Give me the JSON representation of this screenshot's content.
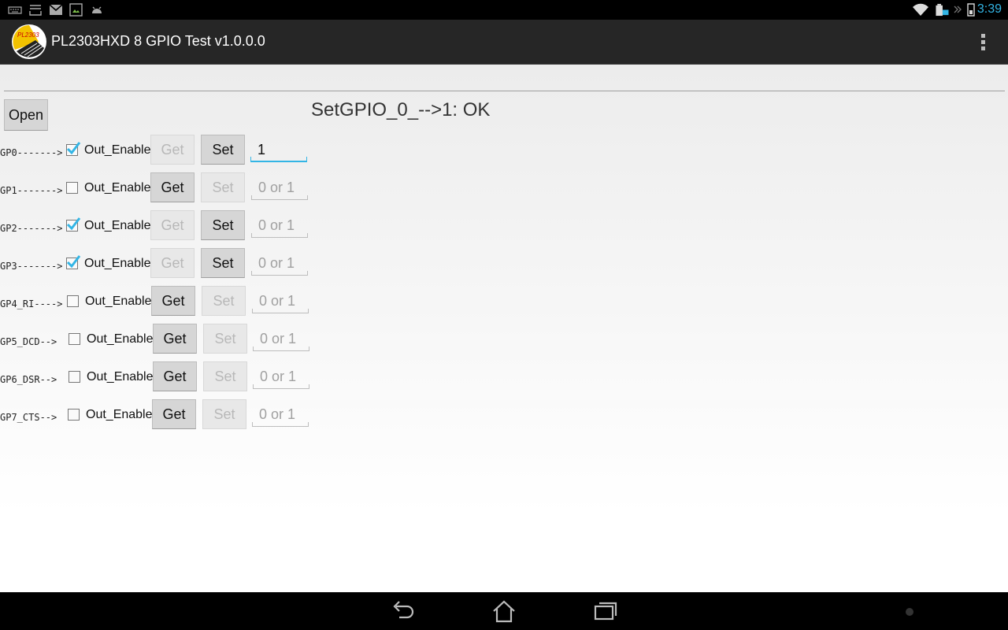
{
  "statusbar": {
    "time": "3:39",
    "accent": "#33b5e5"
  },
  "actionbar": {
    "title": "PL2303HXD 8 GPIO Test v1.0.0.0",
    "logo_text": "PL2303",
    "menu_icon": "overflow-menu-icon"
  },
  "main": {
    "open_label": "Open",
    "status": "SetGPIO_0_-->1: OK"
  },
  "rows": [
    {
      "gp": "GP0------->",
      "checked": true,
      "oe": "Out_Enable",
      "get": "Get",
      "set": "Set",
      "get_enabled": false,
      "set_enabled": true,
      "value": "1",
      "placeholder": "0 or 1"
    },
    {
      "gp": "GP1------->",
      "checked": false,
      "oe": "Out_Enable",
      "get": "Get",
      "set": "Set",
      "get_enabled": true,
      "set_enabled": false,
      "value": "",
      "placeholder": "0 or 1"
    },
    {
      "gp": "GP2------->",
      "checked": true,
      "oe": "Out_Enable",
      "get": "Get",
      "set": "Set",
      "get_enabled": false,
      "set_enabled": true,
      "value": "",
      "placeholder": "0 or 1"
    },
    {
      "gp": "GP3------->",
      "checked": true,
      "oe": "Out_Enable",
      "get": "Get",
      "set": "Set",
      "get_enabled": false,
      "set_enabled": true,
      "value": "",
      "placeholder": "0 or 1"
    },
    {
      "gp": "GP4_RI---->",
      "checked": false,
      "oe": "Out_Enable",
      "get": "Get",
      "set": "Set",
      "get_enabled": true,
      "set_enabled": false,
      "value": "",
      "placeholder": "0 or 1"
    },
    {
      "gp": "GP5_DCD-->",
      "checked": false,
      "oe": "Out_Enable",
      "get": "Get",
      "set": "Set",
      "get_enabled": true,
      "set_enabled": false,
      "value": "",
      "placeholder": "0 or 1"
    },
    {
      "gp": "GP6_DSR-->",
      "checked": false,
      "oe": "Out_Enable",
      "get": "Get",
      "set": "Set",
      "get_enabled": true,
      "set_enabled": false,
      "value": "",
      "placeholder": "0 or 1"
    },
    {
      "gp": "GP7_CTS-->",
      "checked": false,
      "oe": "Out_Enable",
      "get": "Get",
      "set": "Set",
      "get_enabled": true,
      "set_enabled": false,
      "value": "",
      "placeholder": "0 or 1"
    }
  ],
  "navbar": {
    "back_icon": "back-icon",
    "home_icon": "home-icon",
    "recents_icon": "recent-apps-icon"
  }
}
